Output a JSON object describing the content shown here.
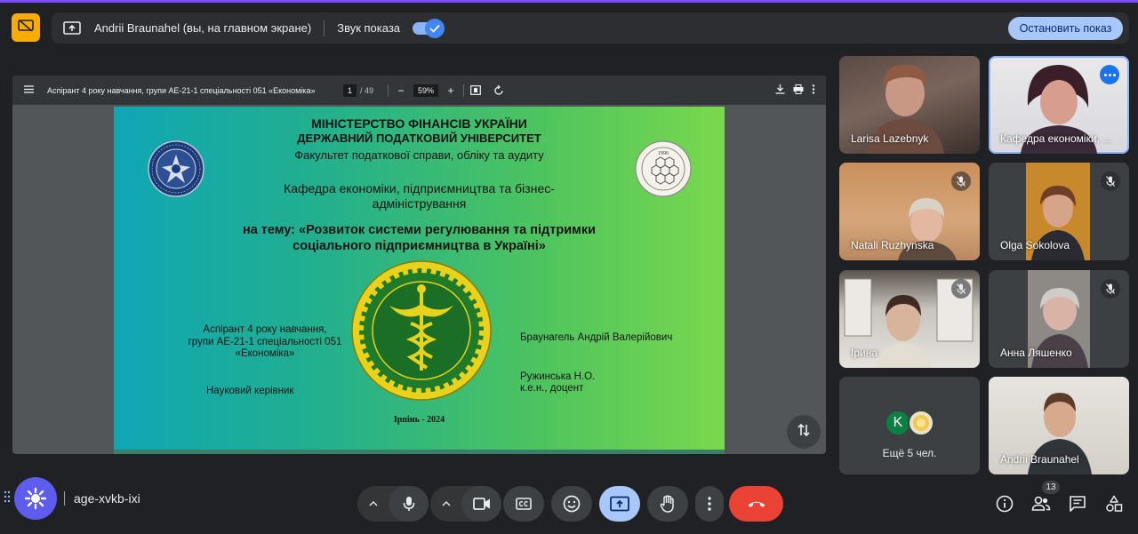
{
  "banner": {
    "presenter_text": "Andrii Braunahel (вы, на главном экране)",
    "sound_label": "Звук показа",
    "sound_on": true,
    "stop_label": "Остановить показ"
  },
  "pdf": {
    "title": "Аспірант 4 року навчання, групи АЕ-21-1 спеціальності 051 «Економіка»",
    "page_current": "1",
    "page_total": "/ 49",
    "zoom": "59%"
  },
  "slide": {
    "ministry": "МІНІСТЕРСТВО ФІНАНСІВ УКРАЇНИ",
    "university": "ДЕРЖАВНИЙ ПОДАТКОВИЙ УНІВЕРСИТЕТ",
    "faculty": "Факультет податкової справи, обліку та аудиту",
    "department_line1": "Кафедра економіки, підприємництва та бізнес-",
    "department_line2": "адміністрування",
    "topic_line1": "на тему: «Розвиток системи регулювання та підтримки",
    "topic_line2": "соціального підприємництва в Україні»",
    "aspirant_line1": "Аспірант 4 року навчання,",
    "aspirant_line2": "групи АЕ-21-1 спеціальності 051",
    "aspirant_line3": "«Економіка»",
    "supervisor_label": "Науковий керівник",
    "author_name": "Браунагель Андрій Валерійович",
    "advisor_line1": "Ружинська Н.О.",
    "advisor_line2": "к.е.н., доцент",
    "city_year": "Ірпінь - 2024",
    "seal_right_year": "1996"
  },
  "participants": [
    {
      "name": "Larisa Lazebnyk",
      "muted": false
    },
    {
      "name": "Кафедра економіки, ...",
      "muted": false,
      "active": true
    },
    {
      "name": "Natali Ruzhynska",
      "muted": true
    },
    {
      "name": "Olga Sokolova",
      "muted": true
    },
    {
      "name": "Ірина",
      "muted": true
    },
    {
      "name": "Анна Ляшенко",
      "muted": true
    },
    {
      "name": "Ещё 5 чел.",
      "avatar_letter": "K"
    },
    {
      "name": "Andrii Braunahel",
      "muted": false
    }
  ],
  "meeting": {
    "code": "age-xvkb-ixi",
    "participant_count": "13"
  },
  "colors": {
    "background": "#202124",
    "accent_blue": "#a8c7fa",
    "end_call": "#ea4335",
    "present_badge": "#f9ab00"
  }
}
